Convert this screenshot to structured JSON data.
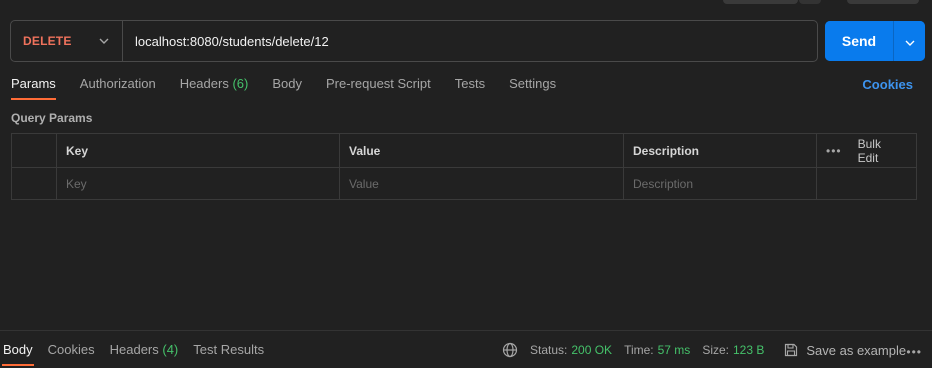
{
  "request": {
    "method": "DELETE",
    "url": "localhost:8080/students/delete/12",
    "send_label": "Send"
  },
  "tabs": [
    {
      "label": "Params"
    },
    {
      "label": "Authorization"
    },
    {
      "label": "Headers",
      "count": "(6)"
    },
    {
      "label": "Body"
    },
    {
      "label": "Pre-request Script"
    },
    {
      "label": "Tests"
    },
    {
      "label": "Settings"
    }
  ],
  "cookies_link": "Cookies",
  "query_params": {
    "title": "Query Params",
    "columns": [
      "Key",
      "Value",
      "Description"
    ],
    "bulk_edit": "Bulk Edit",
    "more": "•••",
    "placeholders": {
      "key": "Key",
      "value": "Value",
      "description": "Description"
    }
  },
  "response": {
    "tabs": [
      {
        "label": "Body"
      },
      {
        "label": "Cookies"
      },
      {
        "label": "Headers",
        "count": "(4)"
      },
      {
        "label": "Test Results"
      }
    ],
    "status_label": "Status:",
    "status_value": "200 OK",
    "time_label": "Time:",
    "time_value": "57 ms",
    "size_label": "Size:",
    "size_value": "123 B",
    "save_example": "Save as example",
    "more": "•••"
  },
  "colors": {
    "accent": "#ff6c37",
    "method": "#f0725c",
    "send": "#097bed",
    "success": "#45c16a",
    "link": "#3d94ef"
  }
}
